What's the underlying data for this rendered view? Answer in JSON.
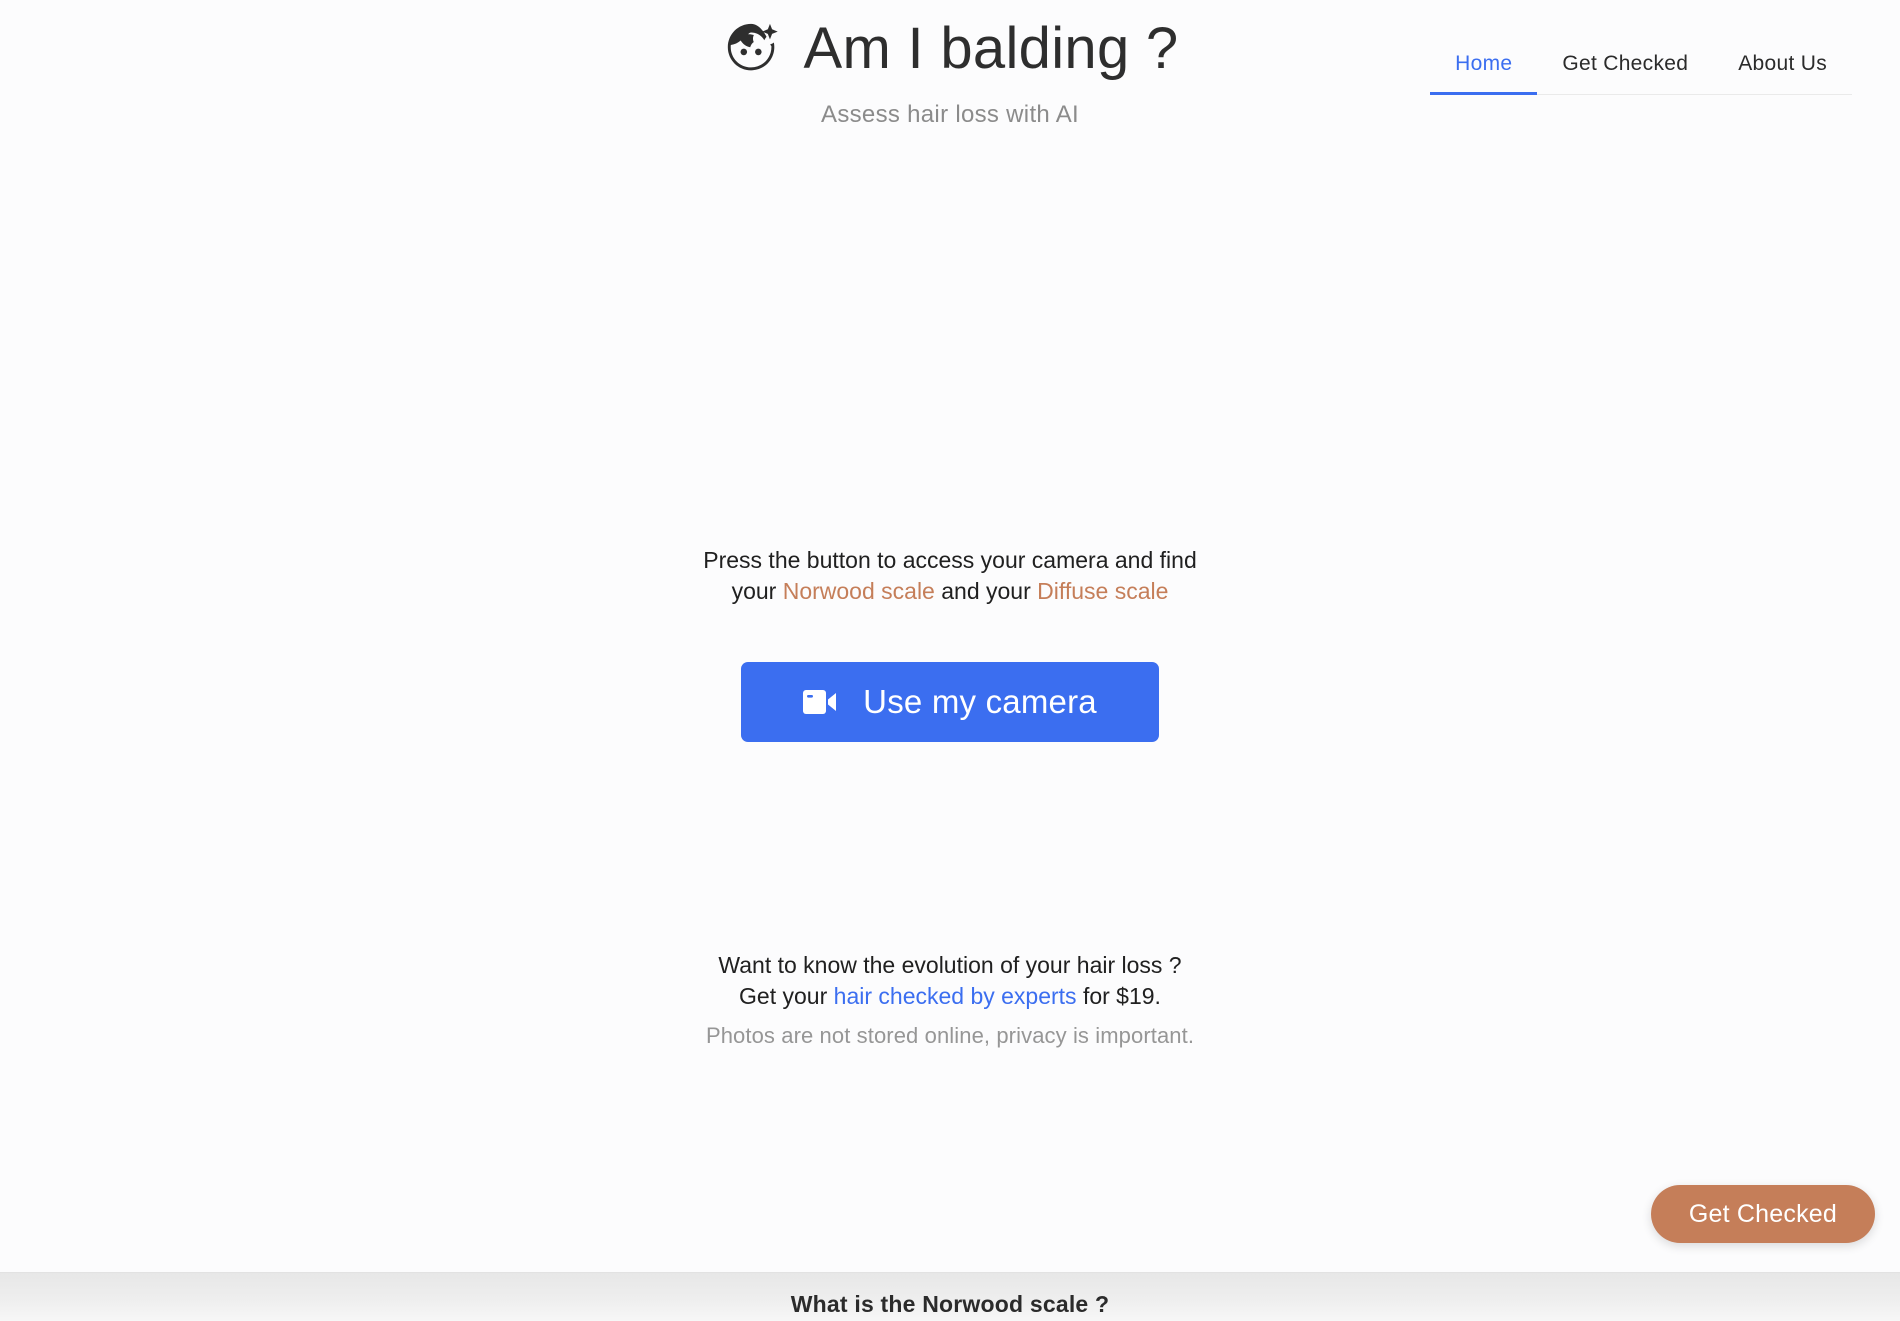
{
  "brand": {
    "logo_icon": "face-sparkle-icon",
    "title": "Am I balding ?",
    "subtitle": "Assess hair loss with AI"
  },
  "nav": {
    "items": [
      {
        "label": "Home",
        "active": true
      },
      {
        "label": "Get Checked",
        "active": false
      },
      {
        "label": "About Us",
        "active": false
      }
    ]
  },
  "main": {
    "instructions": {
      "line1": "Press the button to access your camera and find",
      "line2_prefix": "your ",
      "link_norwood": "Norwood scale",
      "line2_middle": " and your ",
      "link_diffuse": "Diffuse scale"
    },
    "camera_button": {
      "label": "Use my camera",
      "icon": "video-camera-icon"
    },
    "upsell": {
      "line1": "Want to know the evolution of your hair loss ?",
      "line2_prefix": "Get your ",
      "link_experts": "hair checked by experts",
      "line2_suffix": " for $19."
    },
    "privacy_note": "Photos are not stored online, privacy is important."
  },
  "floating_cta": {
    "label": "Get Checked"
  },
  "footer_section": {
    "title": "What is the Norwood scale ?"
  },
  "colors": {
    "background": "#fcfcfd",
    "primary_blue": "#3b6ef0",
    "accent_terracotta": "#c57e59",
    "text_dark": "#2b2b2b",
    "text_muted": "#969696",
    "footer_band": "#e7e7e7"
  }
}
